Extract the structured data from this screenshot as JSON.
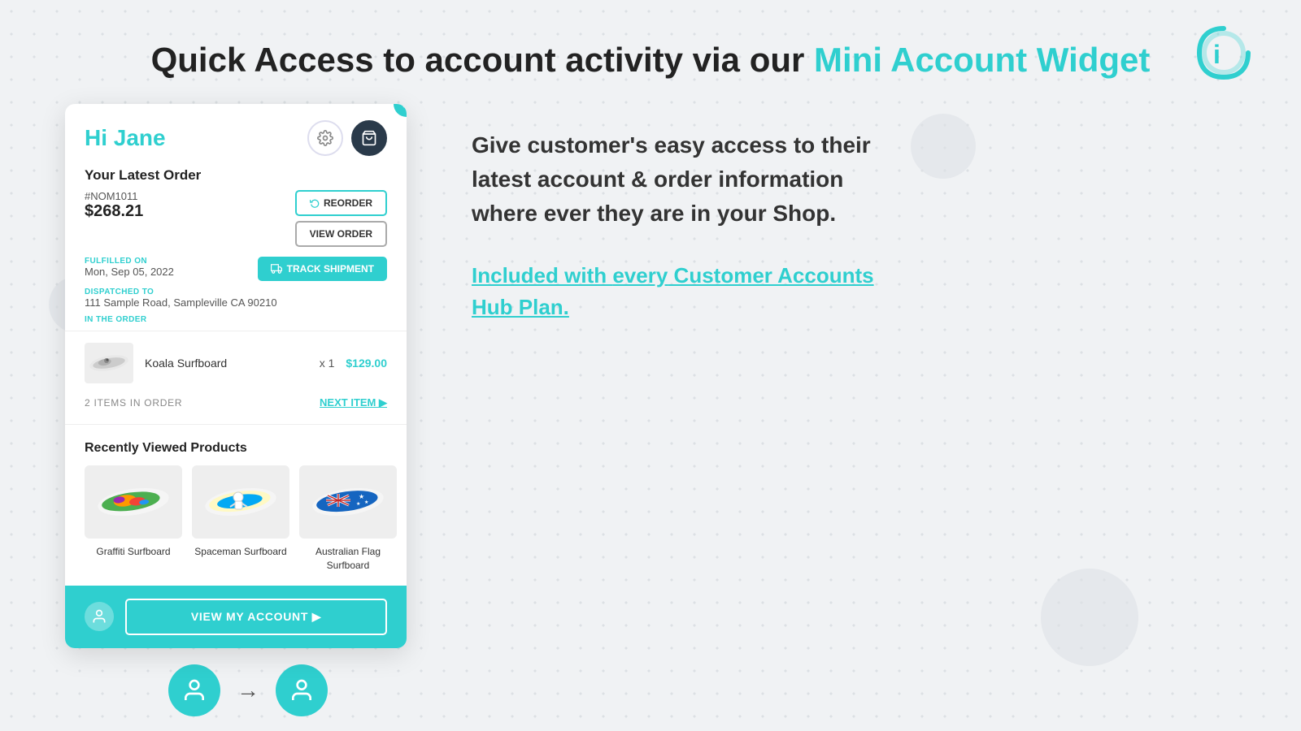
{
  "page": {
    "title_plain": "Quick Access to account activity via our ",
    "title_accent": "Mini Account Widget"
  },
  "logo": {
    "symbol": "⟳",
    "color": "#2fcfcf"
  },
  "widget": {
    "close_label": "×",
    "greeting": "Hi Jane",
    "settings_icon": "⚙",
    "cart_icon": "🛍",
    "latest_order": {
      "section_label": "Your Latest Order",
      "order_id": "#NOM1011",
      "order_amount": "$268.21",
      "reorder_label": "REORDER",
      "view_order_label": "VIEW ORDER",
      "fulfilled_label": "FULFILLED ON",
      "fulfilled_date": "Mon, Sep 05, 2022",
      "track_label": "TRACK SHIPMENT",
      "dispatched_label": "DISPATCHED TO",
      "dispatched_address": "111 Sample Road, Sampleville CA 90210",
      "in_order_label": "IN THE ORDER",
      "item_name": "Koala Surfboard",
      "item_qty": "x 1",
      "item_price": "$129.00",
      "items_count": "2 ITEMS IN ORDER",
      "next_item_label": "NEXT ITEM ▶"
    },
    "recently_viewed": {
      "section_label": "Recently Viewed Products",
      "products": [
        {
          "name": "Graffiti Surfboard",
          "color": "#8bc34a"
        },
        {
          "name": "Spaceman Surfboard",
          "color": "#03a9f4"
        },
        {
          "name": "Australian Flag Surfboard",
          "color": "#1565c0"
        }
      ]
    },
    "footer": {
      "view_account_label": "VIEW MY ACCOUNT ▶"
    }
  },
  "bottom_bar": {
    "user_icon": "👤",
    "arrow": "→",
    "user_icon2": "👤"
  },
  "right_panel": {
    "description": "Give customer's easy access to their latest account & order information where ever they are in your Shop.",
    "cta_prefix": "Included with ",
    "cta_accent": "every",
    "cta_suffix": " Customer Accounts Hub Plan."
  }
}
